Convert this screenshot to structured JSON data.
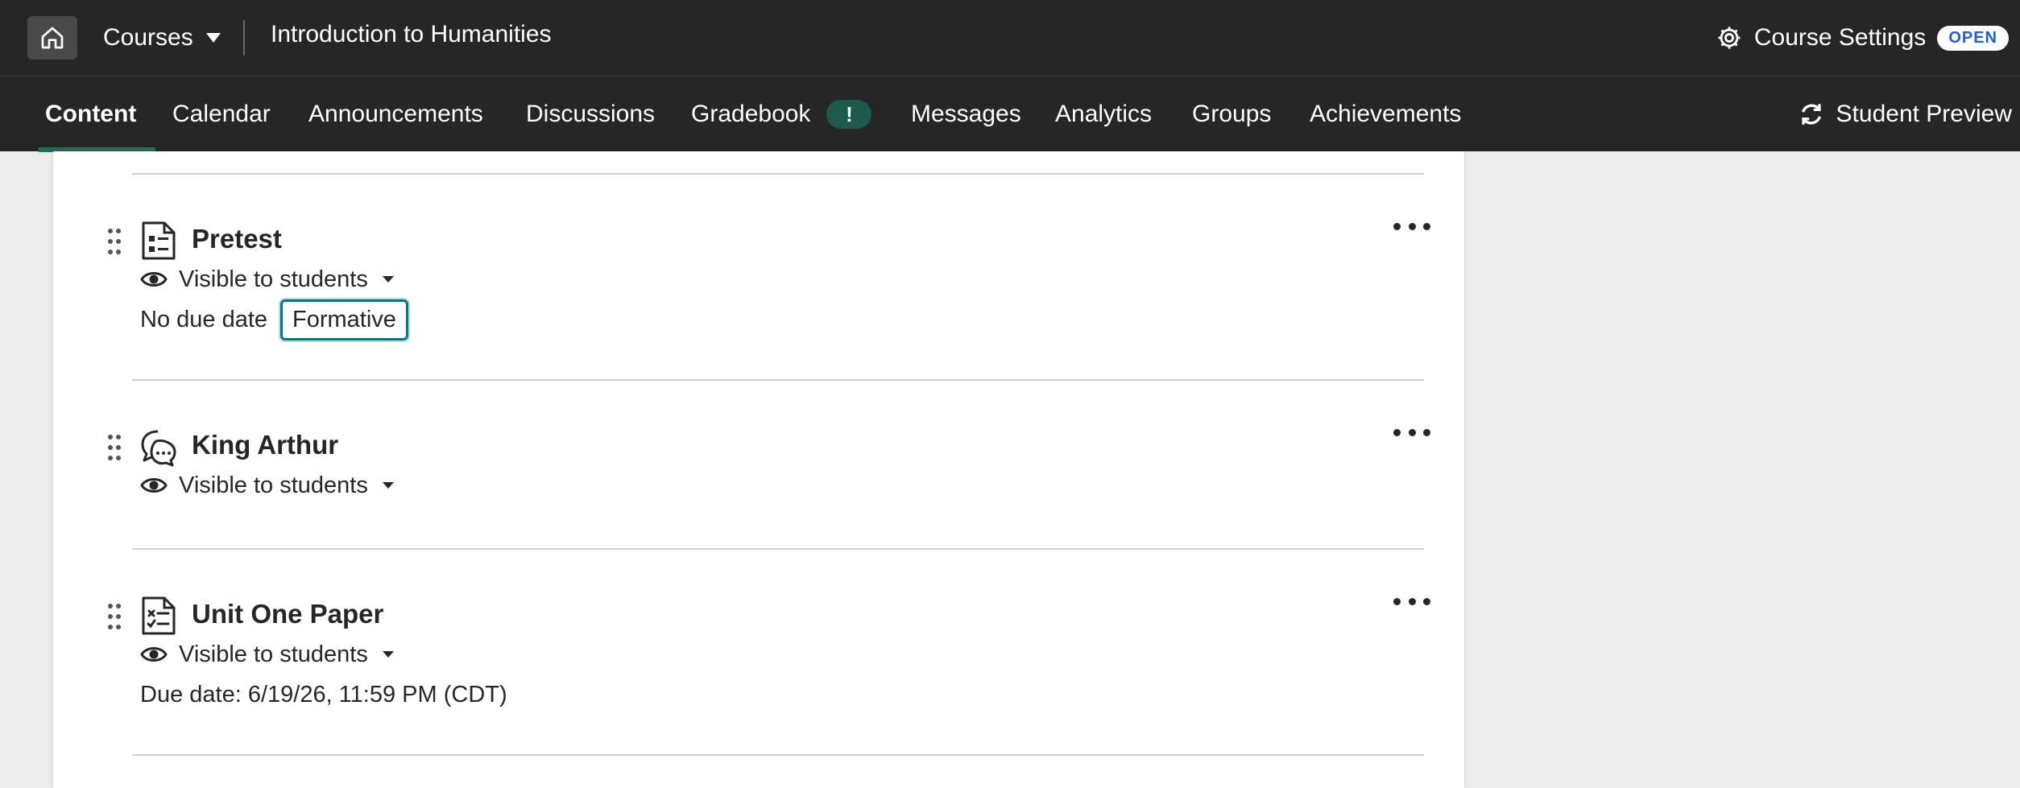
{
  "topbar": {
    "courses_label": "Courses",
    "course_title": "Introduction to Humanities",
    "settings_label": "Course Settings",
    "open_badge": "OPEN"
  },
  "nav": {
    "tabs": [
      {
        "label": "Content",
        "active": true
      },
      {
        "label": "Calendar"
      },
      {
        "label": "Announcements"
      },
      {
        "label": "Discussions"
      },
      {
        "label": "Gradebook",
        "badge": "!"
      },
      {
        "label": "Messages"
      },
      {
        "label": "Analytics"
      },
      {
        "label": "Groups"
      },
      {
        "label": "Achievements"
      }
    ],
    "student_preview": "Student Preview"
  },
  "items": [
    {
      "title": "Pretest",
      "icon": "test-icon",
      "visibility": "Visible to students",
      "due": "No due date",
      "tag": "Formative"
    },
    {
      "title": "King Arthur",
      "icon": "discussion-icon",
      "visibility": "Visible to students"
    },
    {
      "title": "Unit One Paper",
      "icon": "assignment-icon",
      "visibility": "Visible to students",
      "due": "Due date: 6/19/26, 11:59 PM (CDT)"
    }
  ],
  "colors": {
    "topbar_bg": "#262626",
    "accent": "#1b6d60",
    "focus_ring": "#15707a",
    "open_badge_text": "#1f5fd6"
  }
}
